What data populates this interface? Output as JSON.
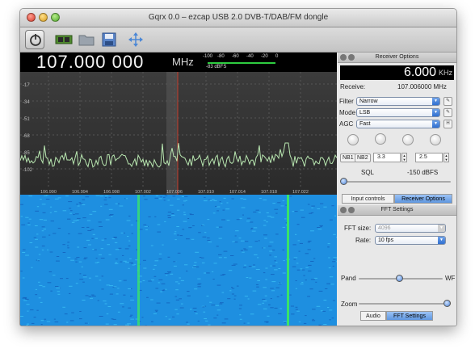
{
  "window": {
    "title": "Gqrx 0.0 – ezcap USB 2.0 DVB-T/DAB/FM dongle"
  },
  "toolbar": {
    "icons": [
      "power-icon",
      "device-chip-icon",
      "folder-icon",
      "save-icon",
      "move-icon"
    ]
  },
  "display": {
    "frequency": "107.000 000",
    "frequency_unit": "MHz",
    "meter_scale": [
      "-100",
      "-80",
      "-60",
      "-40",
      "-20",
      "0"
    ],
    "meter_label": "-83 dBFS",
    "db_ticks": [
      "-17",
      "-34",
      "-51",
      "-68",
      "-85",
      "-102"
    ],
    "freq_ticks": [
      "106.990",
      "106.994",
      "106.998",
      "107.002",
      "107.006",
      "107.010",
      "107.014",
      "107.018",
      "107.022"
    ],
    "colors": {
      "trace": "#b8e6b0",
      "waterfall_bg": "#1e8fe0",
      "waterfall_line": "#39e36a",
      "marker": "#c73b2b"
    }
  },
  "receiver": {
    "header": "Receiver Options",
    "lcd_value": "6.000",
    "lcd_unit": "KHz",
    "receive_label": "Receive:",
    "receive_value": "107.006000 MHz",
    "filter_label": "Filter",
    "filter_value": "Narrow",
    "mode_label": "Mode",
    "mode_value": "LSB",
    "agc_label": "AGC",
    "agc_value": "Fast",
    "agc_button": "H",
    "nb1": "NB1",
    "nb2": "NB2",
    "nb1_value": "3.3",
    "nb2_value": "2.5",
    "sql_label": "SQL",
    "sql_value": "-150 dBFS",
    "tab_input": "Input controls",
    "tab_receiver": "Receiver Options"
  },
  "fft": {
    "header": "FFT Settings",
    "size_label": "FFT size:",
    "size_value": "4096",
    "rate_label": "Rate:",
    "rate_value": "10 fps",
    "pand_label": "Pand",
    "wf_label": "WF",
    "zoom_label": "Zoom",
    "tab_audio": "Audio",
    "tab_fft": "FFT Settings"
  }
}
